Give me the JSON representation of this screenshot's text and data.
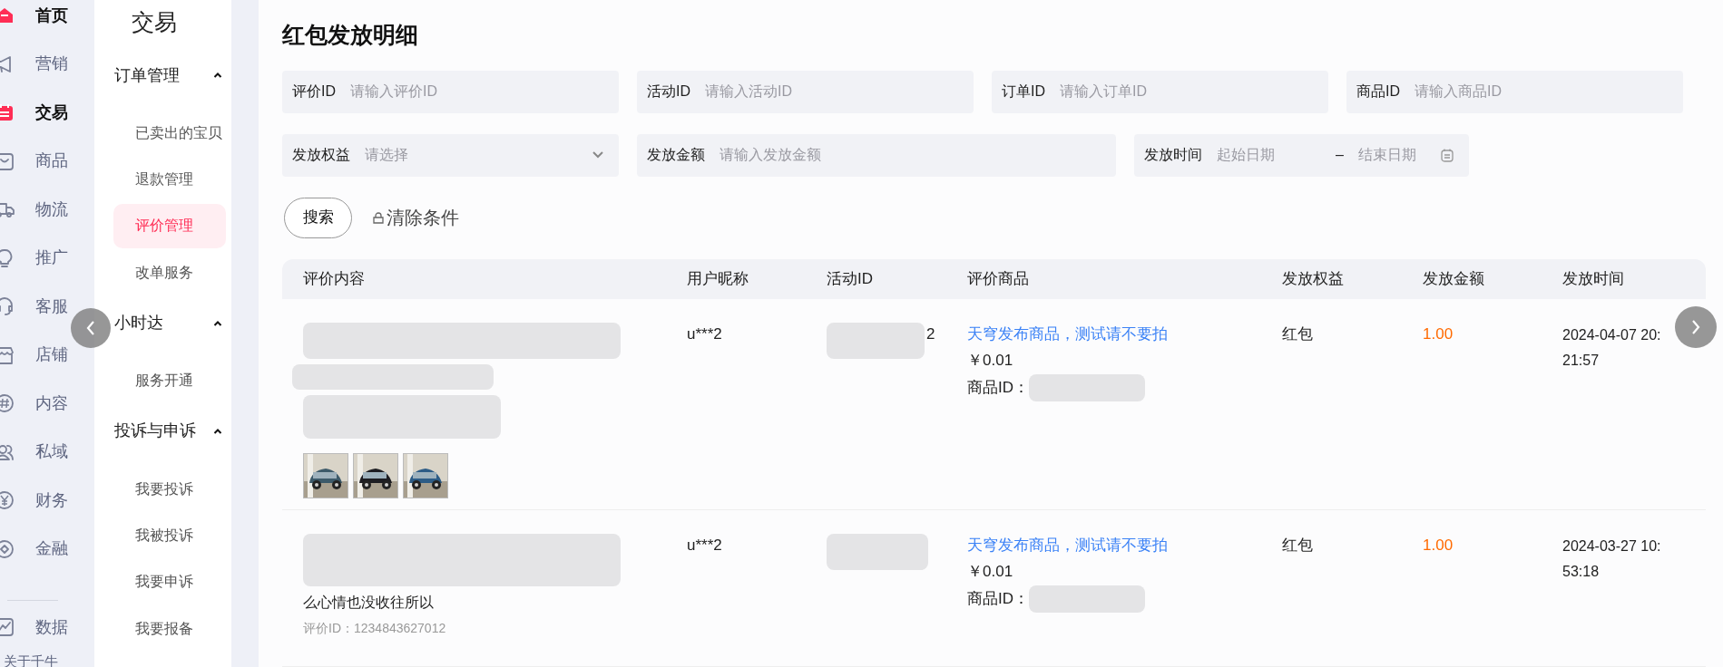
{
  "rail": [
    {
      "label": "首页",
      "selected": true
    },
    {
      "label": "营销",
      "selected": false
    },
    {
      "label": "交易",
      "selected": true
    },
    {
      "label": "商品",
      "selected": false
    },
    {
      "label": "物流",
      "selected": false
    },
    {
      "label": "推广",
      "selected": false
    },
    {
      "label": "客服",
      "selected": false
    },
    {
      "label": "店铺",
      "selected": false
    },
    {
      "label": "内容",
      "selected": false
    },
    {
      "label": "私域",
      "selected": false
    },
    {
      "label": "财务",
      "selected": false
    },
    {
      "label": "金融",
      "selected": false
    },
    {
      "label": "数据",
      "selected": false
    }
  ],
  "rail_footer": "关于千牛",
  "subnav": {
    "title": "交易",
    "groups": [
      {
        "label": "订单管理",
        "expanded": true,
        "children": [
          {
            "label": "已卖出的宝贝",
            "selected": false
          },
          {
            "label": "退款管理",
            "selected": false
          },
          {
            "label": "评价管理",
            "selected": true
          },
          {
            "label": "改单服务",
            "selected": false
          }
        ]
      },
      {
        "label": "小时达",
        "expanded": true,
        "children": [
          {
            "label": "服务开通",
            "selected": false
          }
        ]
      },
      {
        "label": "投诉与申诉",
        "expanded": true,
        "children": [
          {
            "label": "我要投诉",
            "selected": false
          },
          {
            "label": "我被投诉",
            "selected": false
          },
          {
            "label": "我要申诉",
            "selected": false
          },
          {
            "label": "我要报备",
            "selected": false
          }
        ]
      }
    ]
  },
  "page_title": "红包发放明细",
  "filters": [
    {
      "kind": "input",
      "label": "评价ID",
      "placeholder": "请输入评价ID"
    },
    {
      "kind": "input",
      "label": "活动ID",
      "placeholder": "请输入活动ID"
    },
    {
      "kind": "input",
      "label": "订单ID",
      "placeholder": "请输入订单ID"
    },
    {
      "kind": "input",
      "label": "商品ID",
      "placeholder": "请输入商品ID"
    },
    {
      "kind": "select",
      "label": "发放权益",
      "placeholder": "请选择"
    },
    {
      "kind": "input",
      "label": "发放金额",
      "placeholder": "请输入发放金额"
    },
    {
      "kind": "daterange",
      "label": "发放时间",
      "placeholder": "起始日期",
      "end_placeholder": "结束日期",
      "separator": "–"
    }
  ],
  "buttons": {
    "search": "搜索",
    "clear": "清除条件"
  },
  "table": {
    "columns": [
      "评价内容",
      "用户昵称",
      "活动ID",
      "评价商品",
      "发放权益",
      "发放金额",
      "发放时间"
    ],
    "rows": [
      {
        "nickname": "u***2",
        "activity_id_tail": "2",
        "product": "天穹发布商品，测试请不要拍",
        "price": "￥0.01",
        "product_id_label": "商品ID：",
        "benefit": "红包",
        "amount": "1.00",
        "time": "2024-04-07 20:21:57"
      },
      {
        "content_lines": [
          "么心情也没收往所以"
        ],
        "review_id": "评价ID：1234843627012",
        "nickname": "u***2",
        "product": "天穹发布商品，测试请不要拍",
        "price": "￥0.01",
        "product_id_label": "商品ID：",
        "benefit": "红包",
        "amount": "1.00",
        "time": "2024-03-27 10:53:18"
      }
    ]
  }
}
